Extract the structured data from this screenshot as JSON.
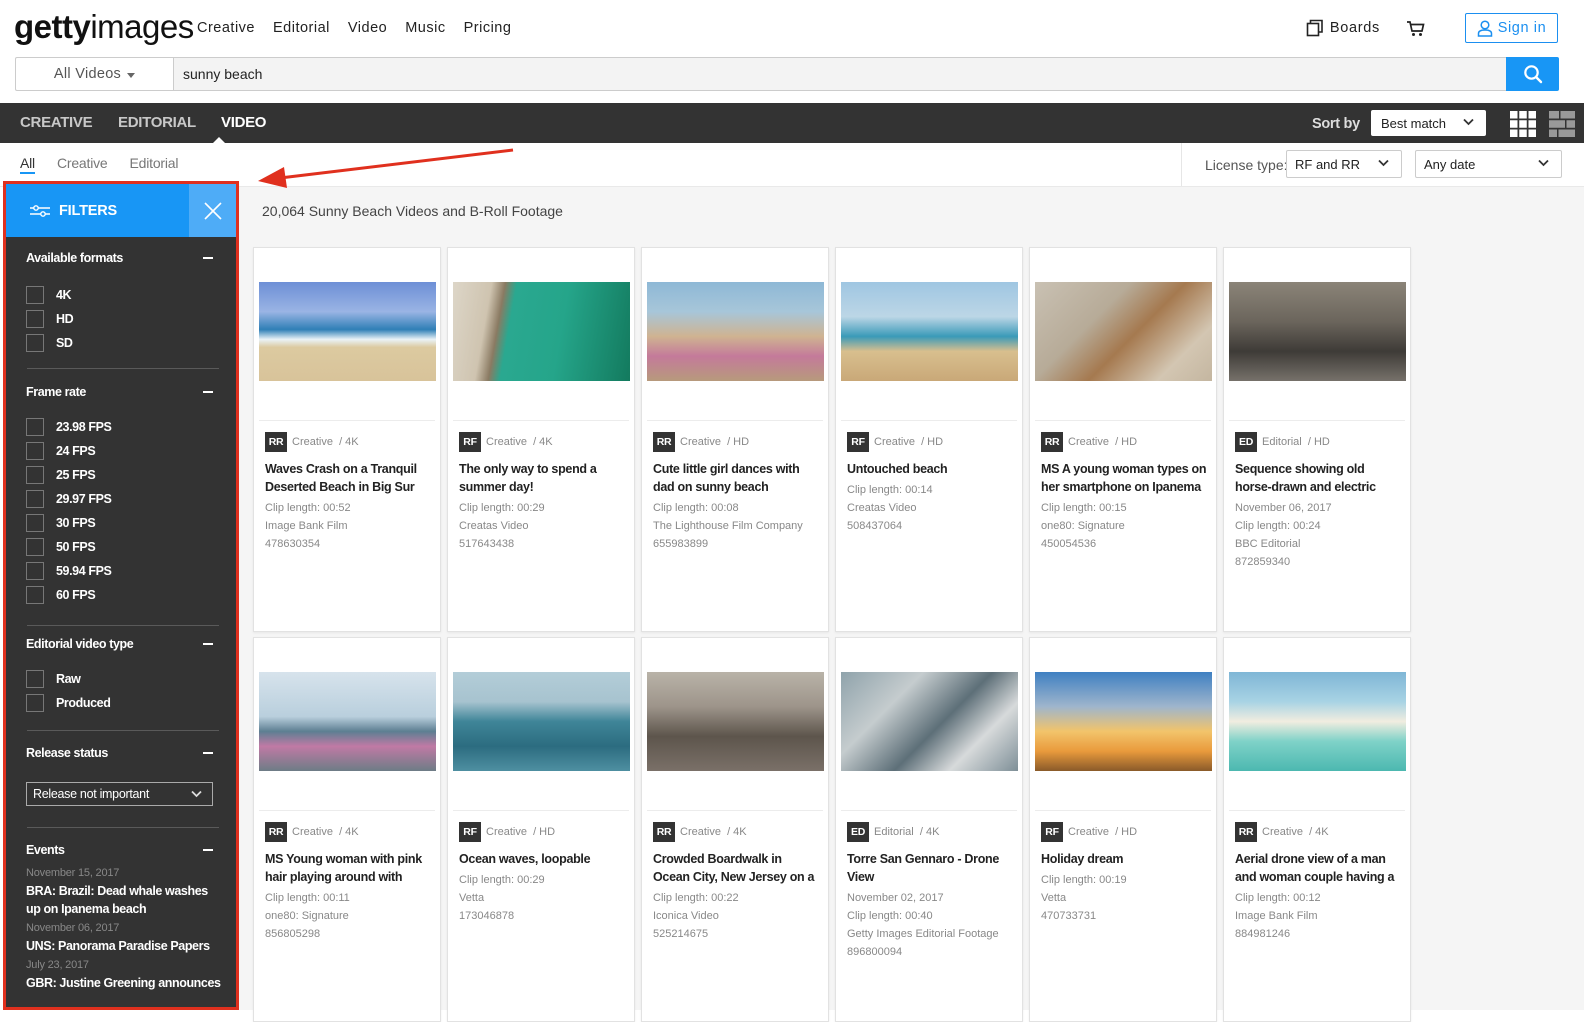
{
  "header": {
    "logo_bold": "getty",
    "logo_light": "images",
    "nav": [
      "Creative",
      "Editorial",
      "Video",
      "Music",
      "Pricing"
    ],
    "boards_label": "Boards",
    "signin_label": "Sign in"
  },
  "search": {
    "scope": "All Videos",
    "query": "sunny beach",
    "placeholder": ""
  },
  "darkbar": {
    "tabs": [
      "CREATIVE",
      "EDITORIAL",
      "VIDEO"
    ],
    "active_tab": "VIDEO",
    "sort_label": "Sort by",
    "sort_value": "Best match"
  },
  "subtabs": {
    "items": [
      "All",
      "Creative",
      "Editorial"
    ],
    "active": "All"
  },
  "license": {
    "label": "License type:",
    "value": "RF and RR",
    "date_value": "Any date"
  },
  "results": {
    "count_text": "20,064 Sunny Beach Videos and B-Roll Footage"
  },
  "colors": {
    "accent": "#1896f5",
    "annotation": "#e0301e",
    "sidebar_bg": "#333333"
  },
  "filters": {
    "title": "FILTERS",
    "sections": {
      "formats": {
        "title": "Available formats",
        "options": [
          "4K",
          "HD",
          "SD"
        ]
      },
      "frame_rate": {
        "title": "Frame rate",
        "options": [
          "23.98 FPS",
          "24 FPS",
          "25 FPS",
          "29.97 FPS",
          "30 FPS",
          "50 FPS",
          "59.94 FPS",
          "60 FPS"
        ]
      },
      "editorial_type": {
        "title": "Editorial video type",
        "options": [
          "Raw",
          "Produced"
        ]
      },
      "release": {
        "title": "Release status",
        "value": "Release not important"
      },
      "events": {
        "title": "Events",
        "items": [
          {
            "date": "November 15, 2017",
            "title": "BRA: Brazil: Dead whale washes up on Ipanema beach"
          },
          {
            "date": "November 06, 2017",
            "title": "UNS: Panorama Paradise Papers"
          },
          {
            "date": "July 23, 2017",
            "title": "GBR: Justine Greening announces"
          }
        ]
      }
    }
  },
  "cards": [
    {
      "badge": "RR",
      "category": "Creative  / 4K",
      "title": "Waves Crash on a Tranquil Deserted Beach in Big Sur",
      "details": [
        "Clip length: 00:52",
        "Image Bank Film",
        "478630354"
      ],
      "thumb": "beach-waves"
    },
    {
      "badge": "RF",
      "category": "Creative  / 4K",
      "title": "The only way to spend a summer day!",
      "details": [
        "Clip length: 00:29",
        "Creatas Video",
        "517643438"
      ],
      "thumb": "aerial-beach"
    },
    {
      "badge": "RR",
      "category": "Creative  / HD",
      "title": "Cute little girl dances with dad on sunny beach",
      "details": [
        "Clip length: 00:08",
        "The Lighthouse Film Company",
        "655983899"
      ],
      "thumb": "girl-beach"
    },
    {
      "badge": "RF",
      "category": "Creative  / HD",
      "title": "Untouched beach",
      "details": [
        "Clip length: 00:14",
        "Creatas Video",
        "508437064"
      ],
      "thumb": "untouched-beach"
    },
    {
      "badge": "RR",
      "category": "Creative  / HD",
      "title": "MS A young woman types on her smartphone on Ipanema",
      "details": [
        "Clip length: 00:15",
        "one80: Signature",
        "450054536"
      ],
      "thumb": "woman-phone"
    },
    {
      "badge": "ED",
      "category": "Editorial  / HD",
      "title": "Sequence showing old horse-drawn and electric trams on",
      "details": [
        "November 06, 2017",
        "Clip length: 00:24",
        "BBC Editorial",
        "872859340"
      ],
      "thumb": "street-people"
    },
    {
      "badge": "RR",
      "category": "Creative  / 4K",
      "title": "MS Young woman with pink hair playing around with",
      "details": [
        "Clip length: 00:11",
        "one80: Signature",
        "856805298"
      ],
      "thumb": "pink-hair"
    },
    {
      "badge": "RF",
      "category": "Creative  / HD",
      "title": "Ocean waves, loopable",
      "details": [
        "Clip length: 00:29",
        "Vetta",
        "173046878"
      ],
      "thumb": "ocean-waves"
    },
    {
      "badge": "RR",
      "category": "Creative  / 4K",
      "title": "Crowded Boardwalk in Ocean City, New Jersey on a Sunny",
      "details": [
        "Clip length: 00:22",
        "Iconica Video",
        "525214675"
      ],
      "thumb": "boardwalk"
    },
    {
      "badge": "ED",
      "category": "Editorial  / 4K",
      "title": "Torre San Gennaro - Drone View",
      "details": [
        "November 02, 2017",
        "Clip length: 00:40",
        "Getty Images Editorial Footage",
        "896800094"
      ],
      "thumb": "drone-boats"
    },
    {
      "badge": "RF",
      "category": "Creative  / HD",
      "title": "Holiday dream",
      "details": [
        "Clip length: 00:19",
        "Vetta",
        "470733731"
      ],
      "thumb": "palm-sunset"
    },
    {
      "badge": "RR",
      "category": "Creative  / 4K",
      "title": "Aerial drone view of a man and woman couple having a",
      "details": [
        "Clip length: 00:12",
        "Image Bank Film",
        "884981246"
      ],
      "thumb": "sandbar-aerial"
    }
  ]
}
